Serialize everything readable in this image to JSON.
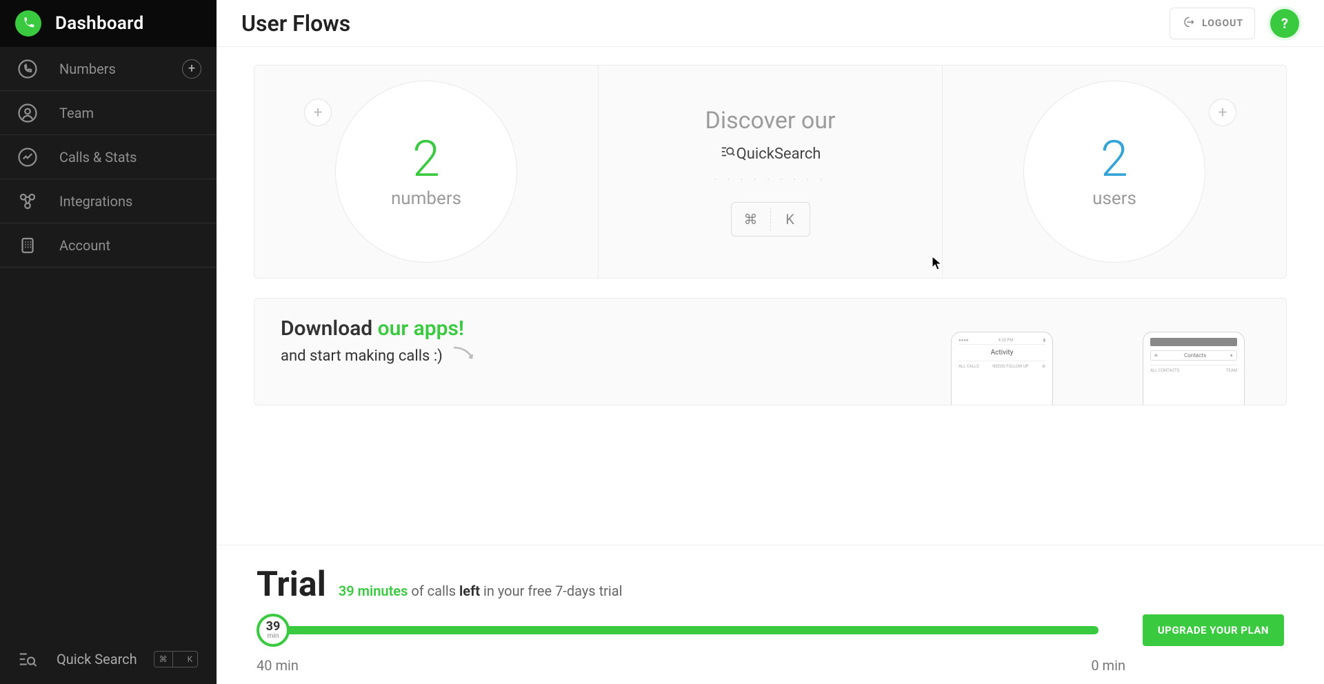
{
  "sidebar": {
    "title": "Dashboard",
    "items": [
      {
        "label": "Numbers",
        "icon": "phone",
        "hasAdd": true
      },
      {
        "label": "Team",
        "icon": "user"
      },
      {
        "label": "Calls & Stats",
        "icon": "chart"
      },
      {
        "label": "Integrations",
        "icon": "nodes"
      },
      {
        "label": "Account",
        "icon": "building"
      }
    ],
    "footer": {
      "label": "Quick Search",
      "k1": "⌘",
      "k2": "K"
    }
  },
  "header": {
    "title": "User Flows",
    "logout": "LOGOUT",
    "help": "?"
  },
  "cards": {
    "numbers": {
      "value": "2",
      "label": "numbers"
    },
    "discover": {
      "title": "Discover our",
      "sub": "QuickSearch",
      "k1": "⌘",
      "k2": "K"
    },
    "users": {
      "value": "2",
      "label": "users"
    }
  },
  "download": {
    "title_a": "Download ",
    "title_b": "our apps!",
    "sub": "and start making calls :)",
    "phone1": {
      "title": "Activity",
      "l1": "ALL CALLS",
      "l2": "NEEDS FOLLOW UP",
      "tl": "4:20 PM"
    },
    "phone2": {
      "title": "Contacts",
      "l1": "ALL CONTACTS",
      "l2": "TEAM"
    }
  },
  "trial": {
    "title": "Trial",
    "accent": "39 minutes",
    "mid": " of calls ",
    "bold": "left",
    "rest": " in your free 7-days trial",
    "knob_value": "39",
    "knob_unit": "min",
    "scale_left": "40 min",
    "scale_right": "0 min",
    "upgrade": "UPGRADE YOUR PLAN"
  }
}
